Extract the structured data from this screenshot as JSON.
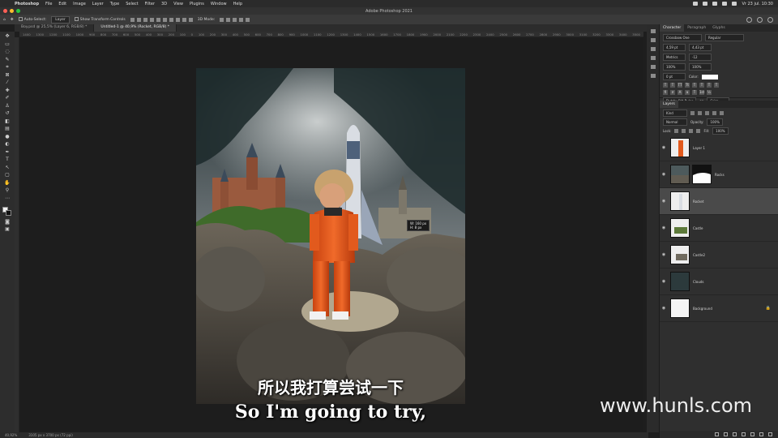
{
  "menubar": {
    "app": "Photoshop",
    "items": [
      "File",
      "Edit",
      "Image",
      "Layer",
      "Type",
      "Select",
      "Filter",
      "3D",
      "View",
      "Plugins",
      "Window",
      "Help"
    ],
    "clock": "Vr 23 jul. 10:30"
  },
  "window": {
    "title": "Adobe Photoshop 2021"
  },
  "options": {
    "auto_select": "Auto-Select:",
    "auto_select_target": "Layer",
    "show_transform": "Show Transform Controls",
    "mode_3d": "3D Mode:"
  },
  "tabs": [
    {
      "label": "Boy.psd @ 25,5% (Layer 6, RGB/8) *",
      "active": false
    },
    {
      "label": "Untitled-1 @ 40,9% (Rocket, RGB/8) *",
      "active": true
    }
  ],
  "ruler": [
    "1400",
    "1300",
    "1200",
    "1100",
    "1000",
    "900",
    "800",
    "700",
    "600",
    "500",
    "400",
    "300",
    "200",
    "100",
    "0",
    "100",
    "200",
    "300",
    "400",
    "500",
    "600",
    "700",
    "800",
    "900",
    "1000",
    "1100",
    "1200",
    "1300",
    "1400",
    "1500",
    "1600",
    "1700",
    "1800",
    "1900",
    "2000",
    "2100",
    "2200",
    "2300",
    "2400",
    "2500",
    "2600",
    "2700",
    "2800",
    "2900",
    "3000",
    "3100",
    "3200",
    "3300",
    "3400",
    "3500"
  ],
  "transform_info": {
    "w": "W: 160 px",
    "h": "H: 8 px"
  },
  "status": {
    "zoom": "40,92%",
    "doc": "3105 px x 3700 px (72 ppi)"
  },
  "character_panel": {
    "tabs": [
      "Character",
      "Paragraph",
      "Glyphs"
    ],
    "font": "Crossbow One",
    "style": "Regular",
    "size": "4,59 pt",
    "leading": "4,43 pt",
    "tracking": "Metrics",
    "kerning": "-12",
    "vscale": "100%",
    "hscale": "100%",
    "baseline": "0 pt",
    "color_label": "Color:",
    "language": "Dutch: Old Rules",
    "aa": "aa",
    "aa_mode": "Crisp"
  },
  "layers_panel": {
    "title": "Layers",
    "filter": "Kind",
    "blend": "Normal",
    "opacity_label": "Opacity:",
    "opacity": "100%",
    "lock_label": "Lock:",
    "fill_label": "Fill:",
    "fill": "100%",
    "layers": [
      {
        "name": "Layer 1",
        "selected": false
      },
      {
        "name": "Rocks",
        "selected": false
      },
      {
        "name": "Rocket",
        "selected": true
      },
      {
        "name": "Castle",
        "selected": false
      },
      {
        "name": "Castle2",
        "selected": false
      },
      {
        "name": "Clouds",
        "selected": false
      },
      {
        "name": "Background",
        "selected": false
      }
    ]
  },
  "subtitles": {
    "cn": "所以我打算尝试一下",
    "en": "So I'm going to try,"
  },
  "watermark": "www.hunls.com",
  "colors": {
    "accent": "#e8531f",
    "panel": "#2f2f2f",
    "canvas": "#1d1d1d"
  }
}
